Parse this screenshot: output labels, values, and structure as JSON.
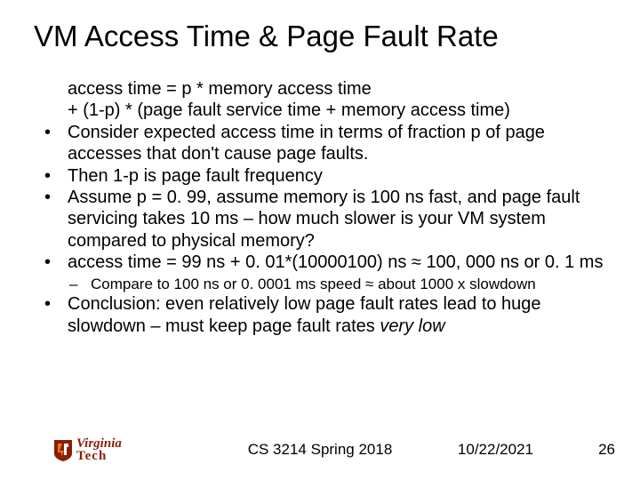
{
  "title": "VM Access Time & Page Fault Rate",
  "preline1": "access time = p * memory access time",
  "preline2": "+ (1-p) * (page fault service time + memory access time)",
  "bullets": {
    "b1": "Consider expected access time in terms of fraction p of page accesses that don't cause page faults.",
    "b2": "Then 1-p is page fault frequency",
    "b3": "Assume p = 0. 99, assume memory is 100 ns fast, and page fault servicing takes 10 ms – how much slower is your VM system compared to physical memory?",
    "b4": "access time = 99 ns + 0. 01*(10000100) ns ≈ 100, 000 ns or 0. 1 ms",
    "sub1": "Compare to 100 ns or 0. 0001 ms speed ≈ about 1000 x slowdown",
    "b5a": "Conclusion: even relatively low page fault rates lead to huge slowdown – must keep page fault rates ",
    "b5b": "very low"
  },
  "footer": {
    "course": "CS 3214 Spring 2018",
    "date": "10/22/2021",
    "page": "26"
  },
  "logo": {
    "line1": "Virginia",
    "line2": "Tech"
  }
}
